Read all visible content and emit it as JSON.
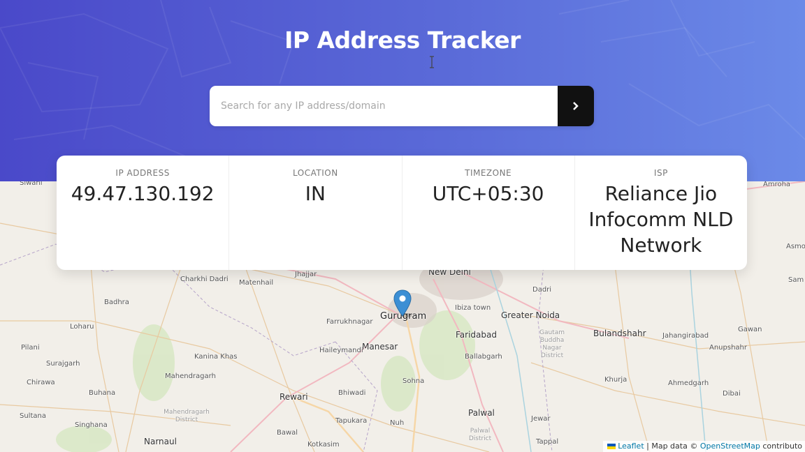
{
  "header": {
    "title": "IP Address Tracker",
    "search_placeholder": "Search for any IP address/domain",
    "search_value": "",
    "submit_icon": "chevron-right-icon"
  },
  "info": [
    {
      "label": "IP ADDRESS",
      "value": "49.47.130.192"
    },
    {
      "label": "LOCATION",
      "value": "IN"
    },
    {
      "label": "TIMEZONE",
      "value": "UTC+05:30"
    },
    {
      "label": "ISP",
      "value": "Reliance Jio Infocomm NLD Network"
    }
  ],
  "map": {
    "places": [
      "Siwani",
      "Amroha",
      "Asmo",
      "Sam",
      "New Delhi",
      "Dadri",
      "Charkhi Dadri",
      "Matenhail",
      "Jhajjar",
      "Badhra",
      "Ibiza town",
      "Greater Noida",
      "Gurugram",
      "Farrukhnagar",
      "Loharu",
      "Faridabad",
      "Bulandshahr",
      "Jahangirabad",
      "Gawan",
      "Manesar",
      "Ballabgarh",
      "Anupshahr",
      "Pilani",
      "Kanina Khas",
      "Haileymandi",
      "Surajgarh",
      "Mahendragarh",
      "Sohna",
      "Khurja",
      "Ahmedgarh",
      "Chirawa",
      "Buhana",
      "Rewari",
      "Bhiwadi",
      "Dibai",
      "Nuh",
      "Palwal",
      "Sultana",
      "Singhana",
      "Tapukara",
      "Jewar",
      "Narnaul",
      "Bawal",
      "Kotkasim",
      "Tappal"
    ],
    "districts": [
      "Gautam Buddha Nagar District",
      "Mahendragarh District",
      "Palwal District"
    ],
    "marker_icon": "map-pin-icon"
  },
  "attribution": {
    "leaflet": "Leaflet",
    "separator": "| Map data ©",
    "osm": "OpenStreetMap",
    "tail": "contributo"
  },
  "colors": {
    "header_start": "#4a49c9",
    "header_end": "#6b8ae8",
    "marker": "#3c8fd4",
    "button": "#111111"
  }
}
